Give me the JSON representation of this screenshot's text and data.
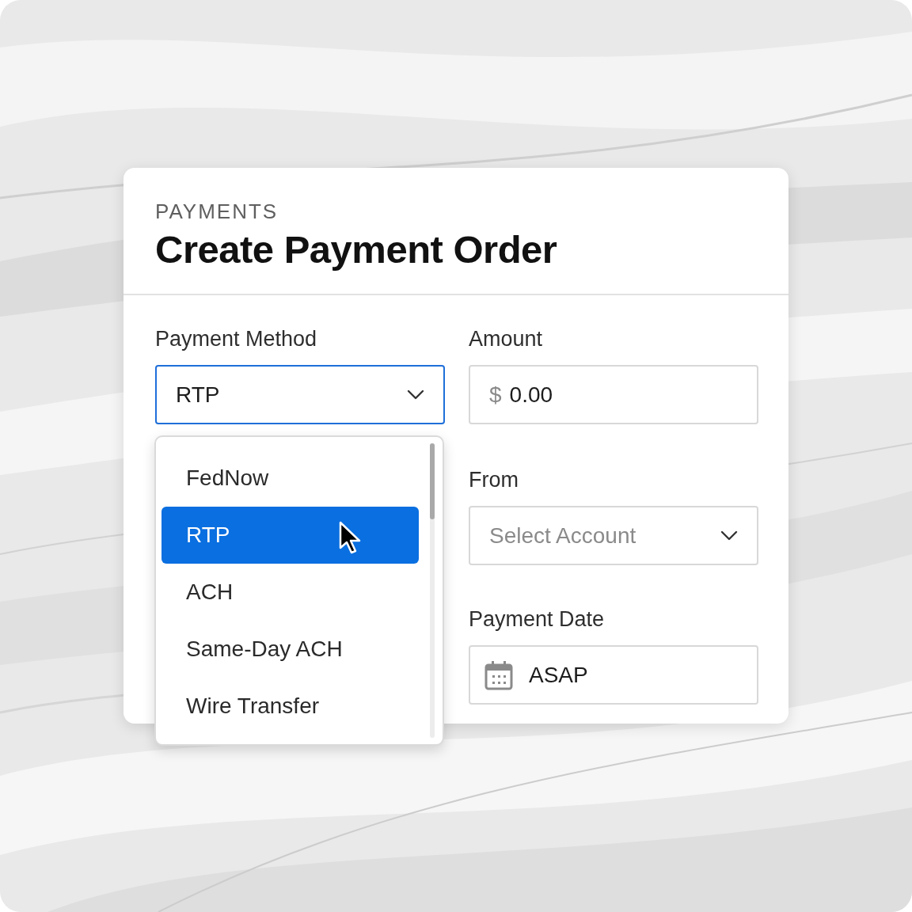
{
  "header": {
    "eyebrow": "PAYMENTS",
    "title": "Create Payment Order"
  },
  "payment_method": {
    "label": "Payment Method",
    "value": "RTP",
    "open": true,
    "options": [
      {
        "label": "FedNow",
        "selected": false
      },
      {
        "label": "RTP",
        "selected": true
      },
      {
        "label": "ACH",
        "selected": false
      },
      {
        "label": "Same-Day ACH",
        "selected": false
      },
      {
        "label": "Wire Transfer",
        "selected": false
      }
    ]
  },
  "amount": {
    "label": "Amount",
    "currency": "$",
    "value": "0.00"
  },
  "from": {
    "label": "From",
    "placeholder": "Select Account"
  },
  "payment_date": {
    "label": "Payment Date",
    "value": "ASAP"
  }
}
